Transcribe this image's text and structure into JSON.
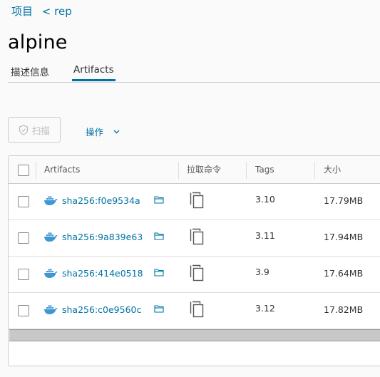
{
  "breadcrumb": {
    "project": "项目",
    "repo": "< rep"
  },
  "page_title": "alpine",
  "tabs": [
    {
      "label": "描述信息"
    },
    {
      "label": "Artifacts"
    }
  ],
  "toolbar": {
    "scan_label": "扫描",
    "action_label": "操作"
  },
  "table": {
    "headers": {
      "artifacts": "Artifacts",
      "pull": "拉取命令",
      "tags": "Tags",
      "size": "大小"
    },
    "rows": [
      {
        "digest": "sha256:f0e9534a",
        "tag": "3.10",
        "size": "17.79MB"
      },
      {
        "digest": "sha256:9a839e63",
        "tag": "3.11",
        "size": "17.94MB"
      },
      {
        "digest": "sha256:414e0518",
        "tag": "3.9",
        "size": "17.64MB"
      },
      {
        "digest": "sha256:c0e9560c",
        "tag": "3.12",
        "size": "17.82MB"
      }
    ]
  },
  "colors": {
    "link": "#0072a3",
    "border": "#cccccc",
    "docker_blue": "#3e96d2"
  },
  "icons": {
    "scan": "shield-check-icon",
    "action": "chevron-down-icon",
    "artifact": "docker-icon",
    "folder": "folder-icon",
    "copy": "copy-icon"
  }
}
